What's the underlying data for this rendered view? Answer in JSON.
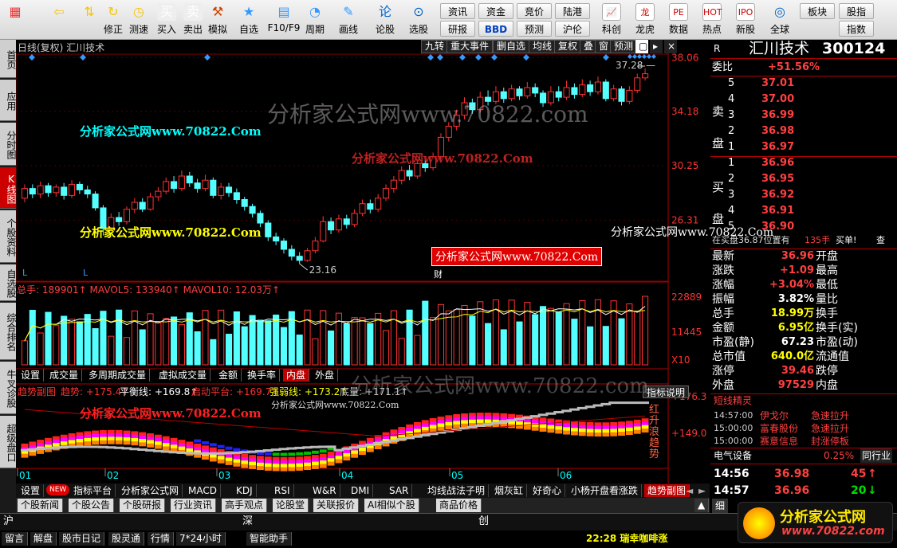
{
  "toolbar": {
    "items": [
      {
        "label": "",
        "icon": "windows-logo-icon"
      },
      {
        "label": "",
        "icon": "back-arrow-icon"
      },
      {
        "label": "",
        "icon": "up-down-icon"
      },
      {
        "label": "修正",
        "icon": "refresh-icon"
      },
      {
        "label": "测速",
        "icon": "clock-icon"
      },
      {
        "label": "买入",
        "icon": "buy-icon"
      },
      {
        "label": "卖出",
        "icon": "sell-icon"
      },
      {
        "label": "模拟",
        "icon": "hammer-icon"
      },
      {
        "label": "自选",
        "icon": "star-icon"
      },
      {
        "label": "F10/F9",
        "icon": "f10-icon"
      },
      {
        "label": "周期",
        "icon": "cycle-icon"
      },
      {
        "label": "画线",
        "icon": "pencil-icon"
      },
      {
        "label": "论股",
        "icon": "chat-icon"
      },
      {
        "label": "选股",
        "icon": "gauge-icon"
      }
    ],
    "right_buttons": [
      "资讯",
      "资金",
      "竞价",
      "陆港",
      "研报",
      "BBD",
      "预测",
      "沪伦"
    ],
    "right_icons": [
      {
        "label": "科创",
        "icon": "chart-up-icon"
      },
      {
        "label": "龙虎",
        "icon": "dragon-icon"
      },
      {
        "label": "数据",
        "icon": "pe-icon"
      },
      {
        "label": "热点",
        "icon": "hot-icon"
      },
      {
        "label": "新股",
        "icon": "ipo-icon"
      }
    ],
    "far_right": [
      "全球",
      "板块",
      "股指",
      "指数"
    ]
  },
  "leftnav": [
    "首页",
    "应用",
    "分时图",
    "K线图",
    "个股资料",
    "自选股",
    "综合排名",
    "牛叉诊股",
    "超级盘口"
  ],
  "kline": {
    "header": "日线(复权) 汇川技术",
    "tools": [
      "九转",
      "重大事件",
      "删自选",
      "均线",
      "复权",
      "叠",
      "窗",
      "预测"
    ],
    "price_ticks": [
      "38.06",
      "34.18",
      "30.25",
      "26.31"
    ],
    "high_label": "37.28",
    "low_label": "23.16",
    "marker_L": "L",
    "marker_cai": "财",
    "candles": [
      {
        "o": 27.9,
        "c": 28.6,
        "h": 28.9,
        "l": 27.6
      },
      {
        "o": 28.6,
        "c": 28.2,
        "h": 28.9,
        "l": 27.9
      },
      {
        "o": 28.2,
        "c": 28.8,
        "h": 29.1,
        "l": 27.9
      },
      {
        "o": 28.8,
        "c": 28.3,
        "h": 29.0,
        "l": 28.0
      },
      {
        "o": 28.3,
        "c": 28.7,
        "h": 28.9,
        "l": 28.0
      },
      {
        "o": 28.7,
        "c": 28.1,
        "h": 29.0,
        "l": 27.8
      },
      {
        "o": 28.1,
        "c": 28.9,
        "h": 29.2,
        "l": 27.9
      },
      {
        "o": 28.9,
        "c": 28.5,
        "h": 29.1,
        "l": 28.2
      },
      {
        "o": 28.5,
        "c": 28.2,
        "h": 28.8,
        "l": 27.9
      },
      {
        "o": 28.2,
        "c": 27.2,
        "h": 28.4,
        "l": 27.0
      },
      {
        "o": 27.2,
        "c": 25.7,
        "h": 27.4,
        "l": 25.2
      },
      {
        "o": 25.7,
        "c": 26.5,
        "h": 26.8,
        "l": 25.5
      },
      {
        "o": 26.5,
        "c": 26.2,
        "h": 26.9,
        "l": 25.9
      },
      {
        "o": 26.2,
        "c": 27.1,
        "h": 27.3,
        "l": 26.0
      },
      {
        "o": 27.1,
        "c": 27.6,
        "h": 27.9,
        "l": 26.8
      },
      {
        "o": 27.6,
        "c": 27.1,
        "h": 27.9,
        "l": 26.9
      },
      {
        "o": 27.1,
        "c": 28.0,
        "h": 28.3,
        "l": 27.0
      },
      {
        "o": 28.0,
        "c": 28.4,
        "h": 28.7,
        "l": 27.7
      },
      {
        "o": 28.4,
        "c": 29.1,
        "h": 29.4,
        "l": 28.2
      },
      {
        "o": 29.1,
        "c": 28.6,
        "h": 29.5,
        "l": 28.3
      },
      {
        "o": 28.6,
        "c": 29.5,
        "h": 29.9,
        "l": 28.4
      },
      {
        "o": 29.5,
        "c": 29.0,
        "h": 29.8,
        "l": 28.7
      },
      {
        "o": 29.0,
        "c": 28.6,
        "h": 29.3,
        "l": 28.3
      },
      {
        "o": 28.6,
        "c": 29.2,
        "h": 29.6,
        "l": 28.4
      },
      {
        "o": 29.2,
        "c": 28.1,
        "h": 29.4,
        "l": 27.9
      },
      {
        "o": 28.1,
        "c": 28.7,
        "h": 29.0,
        "l": 27.8
      },
      {
        "o": 28.7,
        "c": 28.3,
        "h": 29.0,
        "l": 28.0
      },
      {
        "o": 28.3,
        "c": 27.8,
        "h": 28.6,
        "l": 27.5
      },
      {
        "o": 27.8,
        "c": 27.3,
        "h": 28.0,
        "l": 27.0
      },
      {
        "o": 27.3,
        "c": 26.8,
        "h": 27.5,
        "l": 26.5
      },
      {
        "o": 26.8,
        "c": 26.1,
        "h": 27.0,
        "l": 25.8
      },
      {
        "o": 26.1,
        "c": 25.1,
        "h": 26.3,
        "l": 24.8
      },
      {
        "o": 25.1,
        "c": 24.8,
        "h": 25.4,
        "l": 24.5
      },
      {
        "o": 24.8,
        "c": 24.2,
        "h": 25.0,
        "l": 23.9
      },
      {
        "o": 24.2,
        "c": 23.7,
        "h": 24.5,
        "l": 23.4
      },
      {
        "o": 23.7,
        "c": 23.4,
        "h": 24.0,
        "l": 23.16
      },
      {
        "o": 23.4,
        "c": 24.1,
        "h": 24.3,
        "l": 23.3
      },
      {
        "o": 24.1,
        "c": 24.8,
        "h": 25.1,
        "l": 23.9
      },
      {
        "o": 24.8,
        "c": 26.2,
        "h": 26.6,
        "l": 24.7
      },
      {
        "o": 26.2,
        "c": 25.6,
        "h": 26.5,
        "l": 25.3
      },
      {
        "o": 25.6,
        "c": 26.4,
        "h": 26.7,
        "l": 25.4
      },
      {
        "o": 26.4,
        "c": 26.0,
        "h": 26.7,
        "l": 25.7
      },
      {
        "o": 26.0,
        "c": 26.8,
        "h": 27.1,
        "l": 25.8
      },
      {
        "o": 26.8,
        "c": 27.5,
        "h": 27.8,
        "l": 26.6
      },
      {
        "o": 27.5,
        "c": 27.1,
        "h": 27.8,
        "l": 26.8
      },
      {
        "o": 27.1,
        "c": 27.9,
        "h": 28.2,
        "l": 26.9
      },
      {
        "o": 27.9,
        "c": 28.6,
        "h": 28.9,
        "l": 27.7
      },
      {
        "o": 28.6,
        "c": 29.2,
        "h": 29.5,
        "l": 28.3
      },
      {
        "o": 29.2,
        "c": 29.9,
        "h": 30.2,
        "l": 28.9
      },
      {
        "o": 29.9,
        "c": 29.5,
        "h": 30.3,
        "l": 29.2
      },
      {
        "o": 29.5,
        "c": 30.4,
        "h": 30.7,
        "l": 29.3
      },
      {
        "o": 30.4,
        "c": 30.1,
        "h": 30.8,
        "l": 29.8
      },
      {
        "o": 30.1,
        "c": 30.9,
        "h": 31.2,
        "l": 29.9
      },
      {
        "o": 30.9,
        "c": 32.3,
        "h": 32.6,
        "l": 30.7
      },
      {
        "o": 32.3,
        "c": 33.1,
        "h": 33.4,
        "l": 32.0
      },
      {
        "o": 33.1,
        "c": 33.9,
        "h": 34.3,
        "l": 32.8
      },
      {
        "o": 33.9,
        "c": 34.8,
        "h": 35.2,
        "l": 33.6
      },
      {
        "o": 34.8,
        "c": 34.3,
        "h": 35.1,
        "l": 34.0
      },
      {
        "o": 34.3,
        "c": 35.2,
        "h": 35.6,
        "l": 34.1
      },
      {
        "o": 35.2,
        "c": 34.9,
        "h": 35.7,
        "l": 34.6
      },
      {
        "o": 34.9,
        "c": 35.6,
        "h": 36.0,
        "l": 34.7
      },
      {
        "o": 35.6,
        "c": 35.1,
        "h": 35.9,
        "l": 34.8
      },
      {
        "o": 35.1,
        "c": 35.8,
        "h": 36.1,
        "l": 34.9
      },
      {
        "o": 35.8,
        "c": 35.3,
        "h": 36.0,
        "l": 35.0
      },
      {
        "o": 35.3,
        "c": 35.9,
        "h": 36.3,
        "l": 35.1
      },
      {
        "o": 35.9,
        "c": 35.5,
        "h": 36.2,
        "l": 35.2
      },
      {
        "o": 35.5,
        "c": 34.8,
        "h": 35.7,
        "l": 34.5
      },
      {
        "o": 34.8,
        "c": 35.6,
        "h": 36.0,
        "l": 34.6
      },
      {
        "o": 35.6,
        "c": 35.2,
        "h": 36.0,
        "l": 34.9
      },
      {
        "o": 35.2,
        "c": 35.9,
        "h": 36.4,
        "l": 35.0
      },
      {
        "o": 35.9,
        "c": 35.4,
        "h": 36.2,
        "l": 35.1
      },
      {
        "o": 35.4,
        "c": 36.1,
        "h": 36.5,
        "l": 35.2
      },
      {
        "o": 36.1,
        "c": 35.6,
        "h": 36.4,
        "l": 35.3
      },
      {
        "o": 35.6,
        "c": 36.3,
        "h": 36.7,
        "l": 35.4
      },
      {
        "o": 36.3,
        "c": 35.1,
        "h": 36.5,
        "l": 34.9
      },
      {
        "o": 35.1,
        "c": 35.8,
        "h": 36.1,
        "l": 34.9
      },
      {
        "o": 35.8,
        "c": 34.9,
        "h": 36.0,
        "l": 34.6
      },
      {
        "o": 34.9,
        "c": 35.7,
        "h": 36.0,
        "l": 34.7
      },
      {
        "o": 35.7,
        "c": 36.6,
        "h": 36.9,
        "l": 35.5
      },
      {
        "o": 36.6,
        "c": 36.9,
        "h": 37.28,
        "l": 36.4
      }
    ]
  },
  "volume": {
    "header": "总手: 189901↑ MAVOL5: 133940↑ MAVOL10: 12.03万↑",
    "ticks": [
      "22889",
      "11445",
      "X10"
    ],
    "tabs": [
      "设置",
      "成交量",
      "多周期成交量",
      "虚拟成交量",
      "金额",
      "换手率",
      "内盘",
      "外盘"
    ]
  },
  "indicator": {
    "header_parts": [
      "趋势副图",
      "趋势: +175.4↑",
      "平衡线: +169.8↑",
      "启动平台: +169.7↑",
      "强弱线: +173.2↑",
      "底量: +171.1↑"
    ],
    "help_button": "指标说明",
    "ticks": [
      "+176.3",
      "+149.0"
    ],
    "side_text": "红升浪趋势",
    "months": [
      "01",
      "02",
      "03",
      "04",
      "05",
      "06"
    ]
  },
  "indicator_tabs": {
    "new_badge": "NEW",
    "items": [
      "设置",
      "指标平台",
      "分析家公式网",
      "MACD",
      "KDJ",
      "RSI",
      "W&R",
      "DMI",
      "SAR",
      "均线战法子明",
      "烟灰缸",
      "好奇心",
      "小杨开盘看涨跌",
      "趋势副图"
    ]
  },
  "info_tabs": [
    "个股新闻",
    "个股公告",
    "个股研报",
    "行业资讯",
    "高手观点",
    "论股堂",
    "关联报价",
    "AI相似个股",
    "商品价格"
  ],
  "quote": {
    "r_label": "R",
    "title": "汇川技术",
    "code": "300124",
    "weibi_label": "委比",
    "weibi": "+51.56%",
    "sell_label": "卖盘",
    "buy_label": "买盘",
    "asks": [
      {
        "lv": "5",
        "p": "37.01"
      },
      {
        "lv": "4",
        "p": "37.00"
      },
      {
        "lv": "3",
        "p": "36.99"
      },
      {
        "lv": "2",
        "p": "36.98"
      },
      {
        "lv": "1",
        "p": "36.97"
      }
    ],
    "bids": [
      {
        "lv": "1",
        "p": "36.96"
      },
      {
        "lv": "2",
        "p": "36.95"
      },
      {
        "lv": "3",
        "p": "36.92"
      },
      {
        "lv": "4",
        "p": "36.91"
      },
      {
        "lv": "5",
        "p": "36.90"
      }
    ],
    "notice": "在买盘36.87位置有",
    "notice_qty": "135手",
    "notice_act": "买单!",
    "notice_more": "查",
    "stats": [
      {
        "k": "最新",
        "v": "36.96",
        "k2": "开盘",
        "c": "red"
      },
      {
        "k": "涨跌",
        "v": "+1.09",
        "k2": "最高",
        "c": "red"
      },
      {
        "k": "涨幅",
        "v": "+3.04%",
        "k2": "最低",
        "c": "red"
      },
      {
        "k": "振幅",
        "v": "3.82%",
        "k2": "量比",
        "c": "wht"
      },
      {
        "k": "总手",
        "v": "18.99万",
        "k2": "换手",
        "c": "yel"
      },
      {
        "k": "金额",
        "v": "6.95亿",
        "k2": "换手(实)",
        "c": "yel"
      },
      {
        "k": "市盈(静)",
        "v": "67.23",
        "k2": "市盈(动)",
        "c": "wht"
      },
      {
        "k": "总市值",
        "v": "640.0亿",
        "k2": "流通值",
        "c": "yel"
      },
      {
        "k": "涨停",
        "v": "39.46",
        "k2": "跌停",
        "c": "red"
      },
      {
        "k": "外盘",
        "v": "97529",
        "k2": "内盘",
        "c": "red"
      }
    ],
    "sprite_title": "短线精灵",
    "sprite": [
      {
        "t": "14:57:00",
        "n": "伊戈尔",
        "e": "急速拉升"
      },
      {
        "t": "15:00:00",
        "n": "富春股份",
        "e": "急速拉升"
      },
      {
        "t": "15:00:00",
        "n": "赛意信息",
        "e": "封涨停板"
      }
    ],
    "industry": "电气设备",
    "industry_pct": "0.25%",
    "industry_tab": "同行业",
    "ticks": [
      {
        "t": "14:56",
        "p": "36.98",
        "v": "45",
        "arrow": "↑",
        "c": "red"
      },
      {
        "t": "14:57",
        "p": "36.96",
        "v": "20",
        "arrow": "↓",
        "c": "grn"
      }
    ],
    "tab_xi": "细",
    "tab_zhong": "中"
  },
  "statusbar": {
    "markets": [
      "沪",
      "深",
      "创"
    ],
    "items": [
      "留言",
      "解盘",
      "股市日记",
      "股灵通",
      "行情",
      "7*24小时",
      "智能助手"
    ],
    "news": "22:28 瑞幸咖啡涨"
  },
  "watermarks": {
    "site": "分析家公式网www.70822.Com",
    "big": "分析家公式网www.70822.com",
    "cn": "分析家公式网",
    "url": "www.70822.com"
  },
  "colors": {
    "up": "#ff3232",
    "down": "#54ffff",
    "accent": "#c00000"
  }
}
